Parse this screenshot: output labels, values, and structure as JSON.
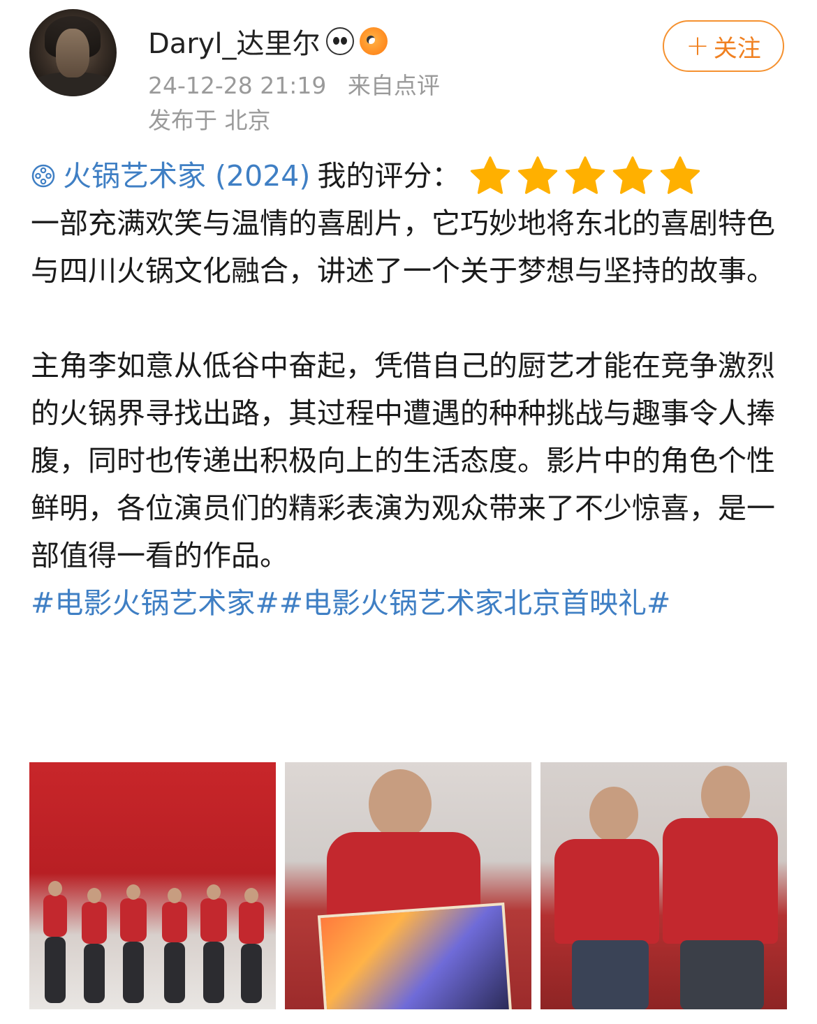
{
  "post": {
    "username": "Daryl_达里尔",
    "badges": [
      "panda-badge-icon",
      "fish-badge-icon"
    ],
    "timestamp": "24-12-28 21:19",
    "source": "来自点评",
    "location": "发布于 北京",
    "follow_label": "关注",
    "follow_plus": "+"
  },
  "review": {
    "movie_title": "火锅艺术家 (2024)",
    "rating_label": "我的评分：",
    "stars": 5,
    "paragraph1": "一部充满欢笑与温情的喜剧片，它巧妙地将东北的喜剧特色与四川火锅文化融合，讲述了一个关于梦想与坚持的故事。",
    "paragraph2": "主角李如意从低谷中奋起，凭借自己的厨艺才能在竞争激烈的火锅界寻找出路，其过程中遭遇的种种挑战与趣事令人捧腹，同时也传递出积极向上的生活态度。影片中的角色个性鲜明，各位演员们的精彩表演为观众带来了不少惊喜，是一部值得一看的作品。",
    "tags": "#电影火锅艺术家##电影火锅艺术家北京首映礼#"
  },
  "colors": {
    "link": "#3f7fc4",
    "star": "#ffb000",
    "follow": "#f08020",
    "meta": "#9a9a9a"
  },
  "photos": [
    {
      "name": "premiere-stage-photo"
    },
    {
      "name": "actor-with-poster-photo"
    },
    {
      "name": "two-actors-photo"
    }
  ]
}
